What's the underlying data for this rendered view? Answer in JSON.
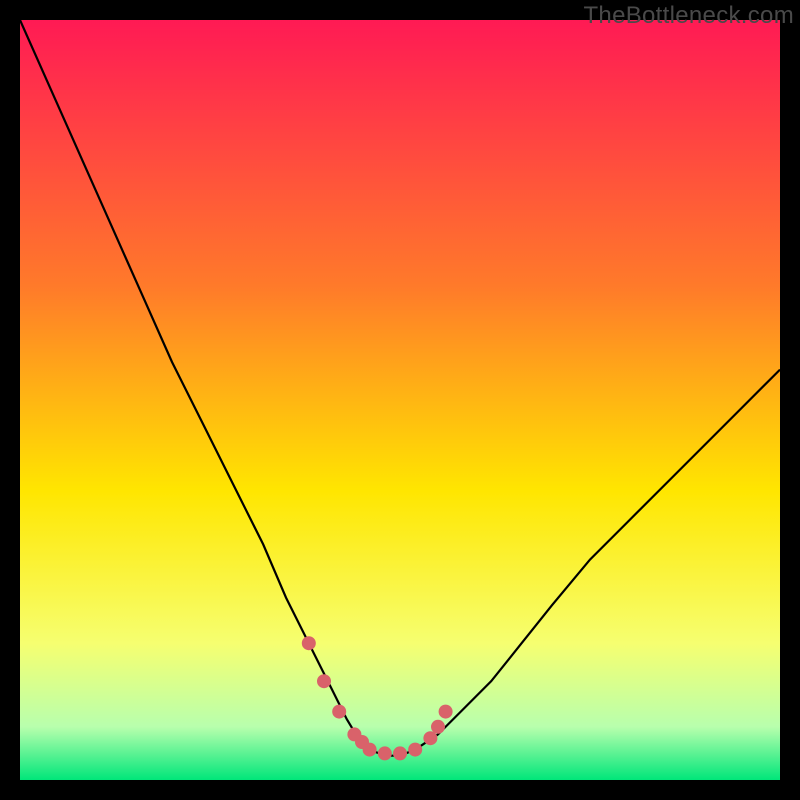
{
  "watermark": "TheBottleneck.com",
  "colors": {
    "frame": "#000000",
    "gradient_top": "#ff1a54",
    "gradient_mid1": "#ff7a2a",
    "gradient_mid2": "#ffe600",
    "gradient_low1": "#f6ff70",
    "gradient_low2": "#b8ffad",
    "gradient_bottom": "#00e67a",
    "curve": "#000000",
    "marker": "#d9626a"
  },
  "chart_data": {
    "type": "line",
    "title": "",
    "xlabel": "",
    "ylabel": "",
    "xlim": [
      0,
      100
    ],
    "ylim": [
      0,
      100
    ],
    "series": [
      {
        "name": "bottleneck-curve",
        "x": [
          0,
          4,
          8,
          12,
          16,
          20,
          24,
          28,
          32,
          35,
          38,
          41,
          43,
          44.5,
          46,
          48,
          50,
          52,
          55,
          58,
          62,
          66,
          70,
          75,
          80,
          85,
          90,
          95,
          100
        ],
        "y": [
          100,
          91,
          82,
          73,
          64,
          55,
          47,
          39,
          31,
          24,
          18,
          12,
          8,
          5.5,
          4,
          3.2,
          3.2,
          4,
          6,
          9,
          13,
          18,
          23,
          29,
          34,
          39,
          44,
          49,
          54
        ]
      }
    ],
    "markers": {
      "name": "optimal-zone",
      "x": [
        38,
        40,
        42,
        44,
        45,
        46,
        48,
        50,
        52,
        54,
        55,
        56
      ],
      "y": [
        18,
        13,
        9,
        6,
        5,
        4,
        3.5,
        3.5,
        4,
        5.5,
        7,
        9
      ]
    }
  }
}
